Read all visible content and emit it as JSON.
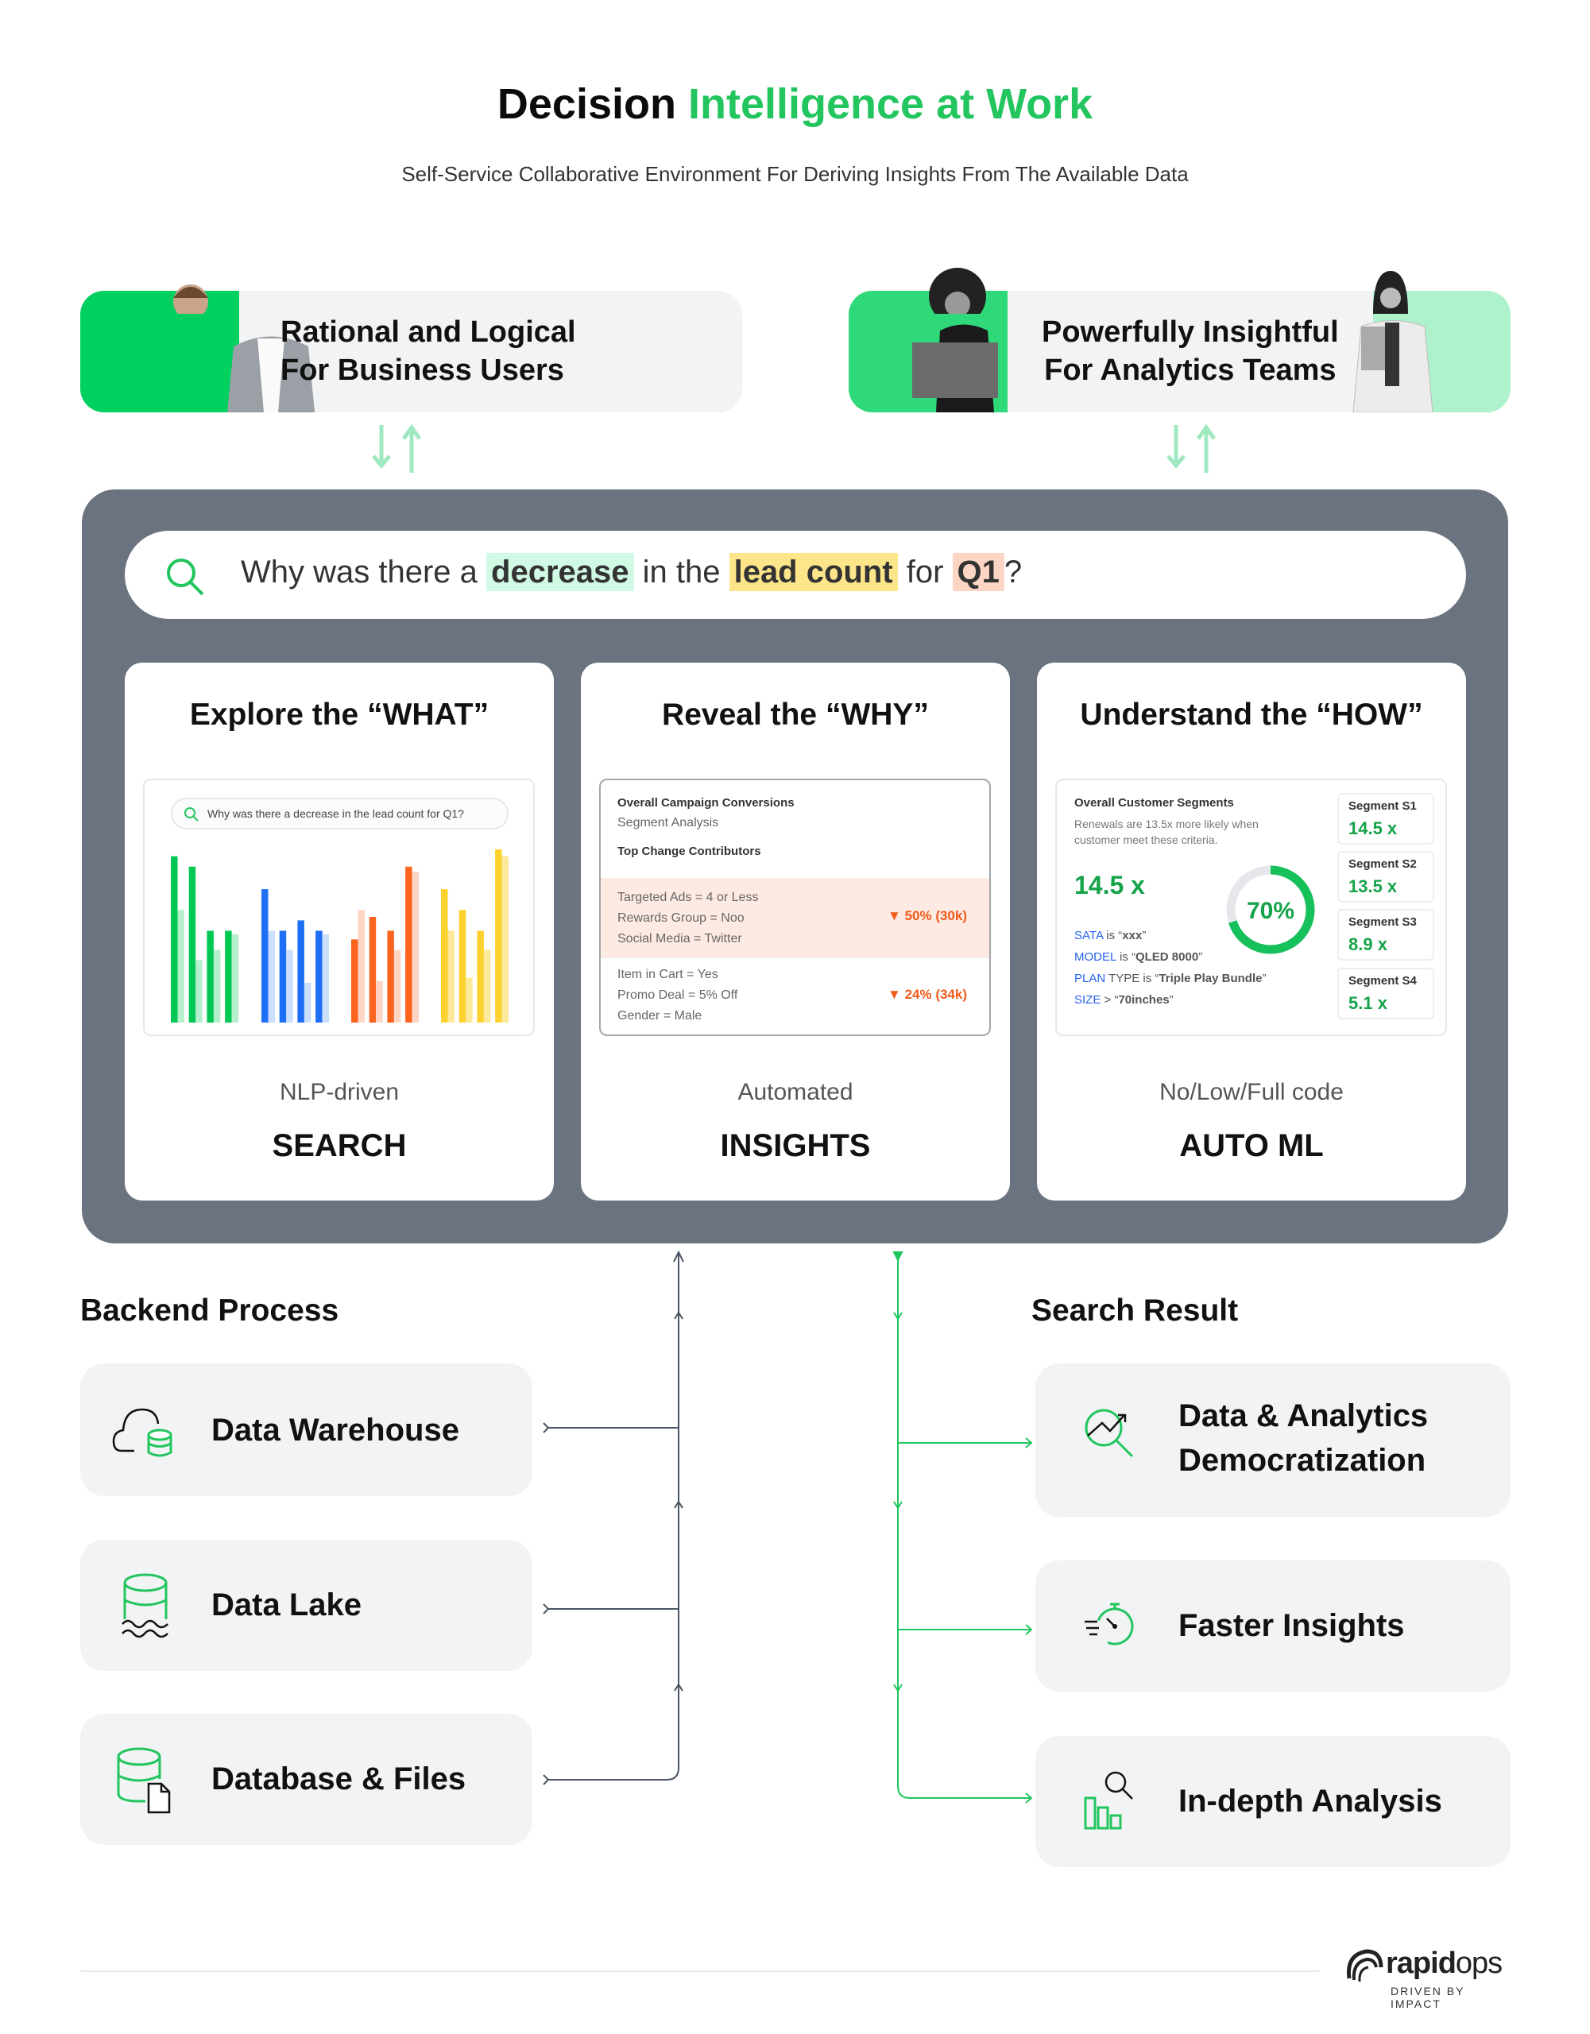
{
  "header": {
    "title_part1": "Decision",
    "title_part2": "Intelligence at Work",
    "subtitle": "Self-Service Collaborative Environment For Deriving Insights From The Available Data"
  },
  "banners": [
    {
      "line1": "Rational and Logical",
      "line2": "For Business Users"
    },
    {
      "line1": "Powerfully Insightful",
      "line2": "For Analytics Teams"
    }
  ],
  "search": {
    "parts": [
      "Why was there a ",
      "decrease",
      " in the ",
      "lead count",
      " for ",
      "Q1",
      "?"
    ],
    "highlight_colors": [
      "#d1fae5",
      "#fde68a",
      "#fdd5c4"
    ]
  },
  "cards": [
    {
      "title": "Explore the “WHAT”",
      "subtitle": "NLP-driven",
      "label": "SEARCH",
      "mini_search": "Why was there a decrease in the lead count for Q1?",
      "mini_chart": {
        "type": "bar",
        "colors": [
          [
            "#00c853",
            "#b5efcc"
          ],
          [
            "#1e6ff5",
            "#cadffb"
          ],
          [
            "#fa641e",
            "#fdd5c4"
          ],
          [
            "#fdd22e",
            "#fde99a"
          ]
        ],
        "groups": [
          [
            [
              96,
              65
            ],
            [
              90,
              36
            ],
            [
              53,
              42
            ],
            [
              53,
              51
            ]
          ],
          [
            [
              77,
              53
            ],
            [
              53,
              42
            ],
            [
              59,
              23
            ],
            [
              53,
              51
            ]
          ],
          [
            [
              48,
              65
            ],
            [
              61,
              24
            ],
            [
              53,
              42
            ],
            [
              90,
              87
            ]
          ],
          [
            [
              77,
              53
            ],
            [
              65,
              26
            ],
            [
              53,
              42
            ],
            [
              100,
              96
            ]
          ]
        ]
      }
    },
    {
      "title": "Reveal the “WHY”",
      "subtitle": "Automated",
      "label": "INSIGHTS",
      "panel_title": "Overall Campaign Conversions",
      "panel_sub": "Segment Analysis",
      "contrib_title": "Top Change Contributors",
      "rows": [
        {
          "lines": [
            "Targeted Ads = 4 or Less",
            "Rewards Group = Noo",
            "Social Media = Twitter"
          ],
          "value": "▼ 50% (30k)"
        },
        {
          "lines": [
            "Item in Cart = Yes",
            "Promo Deal = 5% Off",
            "Gender = Male"
          ],
          "value": "▼ 24% (34k)"
        }
      ]
    },
    {
      "title": "Understand the “HOW”",
      "subtitle": "No/Low/Full code",
      "label": "AUTO ML",
      "panel_title": "Overall Customer Segments",
      "panel_desc1": "Renewals are 13.5x more likely when",
      "panel_desc2": "customer meet these criteria.",
      "big_value": "14.5 x",
      "donut_label": "70%",
      "donut_fraction": 0.7,
      "criteria": [
        {
          "key": "SATA",
          "mid": " is “",
          "val": "xxx",
          "end": "”"
        },
        {
          "key": "MODEL",
          "mid": " is “",
          "val": "QLED 8000",
          "end": "”"
        },
        {
          "key": "PLAN",
          "mid": " TYPE is “",
          "val": "Triple Play Bundle",
          "end": "”"
        },
        {
          "key": "SIZE",
          "mid": " > “",
          "val": "70inches",
          "end": "”"
        }
      ],
      "segments": [
        {
          "name": "Segment S1",
          "value": "14.5 x"
        },
        {
          "name": "Segment S2",
          "value": "13.5 x"
        },
        {
          "name": "Segment S3",
          "value": "8.9 x"
        },
        {
          "name": "Segment S4",
          "value": "5.1 x"
        }
      ]
    }
  ],
  "backend": {
    "title": "Backend Process",
    "items": [
      {
        "label": "Data Warehouse",
        "icon": "cloud-database-icon"
      },
      {
        "label": "Data Lake",
        "icon": "data-lake-icon"
      },
      {
        "label": "Database & Files",
        "icon": "database-file-icon"
      }
    ]
  },
  "results": {
    "title": "Search Result",
    "items": [
      {
        "line1": "Data & Analytics",
        "line2": "Democratization",
        "icon": "analytics-search-icon"
      },
      {
        "line1": "Faster Insights",
        "icon": "stopwatch-icon"
      },
      {
        "line1": "In-depth Analysis",
        "icon": "bar-chart-search-icon"
      }
    ]
  },
  "logo": {
    "brand_bold": "rapid",
    "brand_light": "ops",
    "tagline": "DRIVEN BY IMPACT"
  },
  "colors": {
    "accent": "#22c55e",
    "panel": "#6b7280",
    "box": "#f2f3f5",
    "negative": "#f05a1a",
    "link_blue": "#2563eb"
  }
}
